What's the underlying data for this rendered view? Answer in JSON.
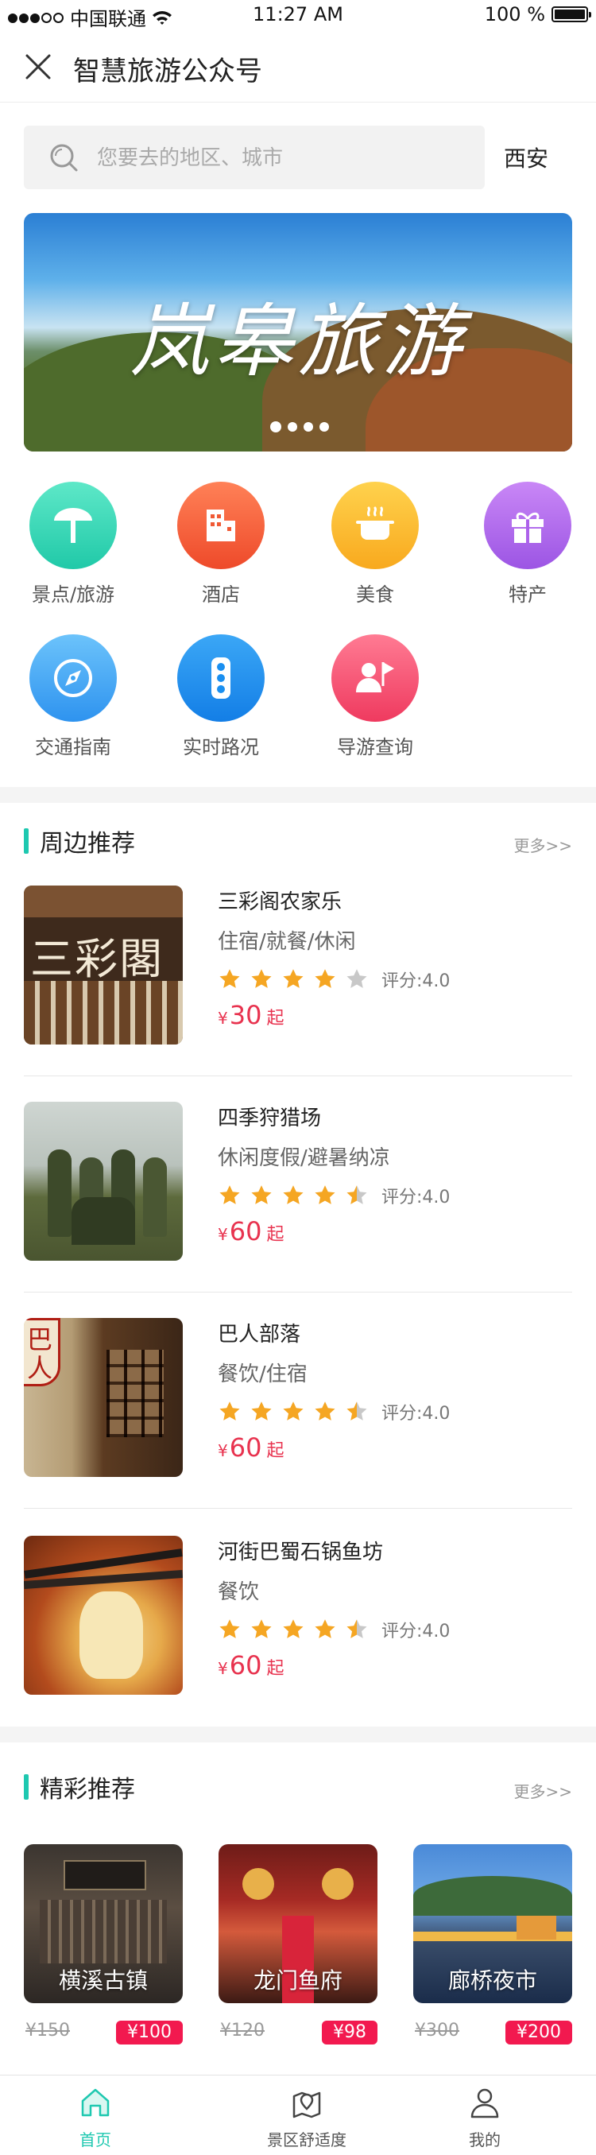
{
  "status_bar": {
    "carrier": "中国联通",
    "time": "11:27 AM",
    "battery": "100 %"
  },
  "header": {
    "title": "智慧旅游公众号"
  },
  "search": {
    "placeholder": "您要去的地区、城市",
    "city": "西安"
  },
  "banner": {
    "caption": "岚皋旅游",
    "slide_count": 4,
    "active_slide": 1
  },
  "categories": [
    {
      "label": "景点/旅游",
      "icon": "palm-tree-icon",
      "color": "#2fd6b3"
    },
    {
      "label": "酒店",
      "icon": "hotel-building-icon",
      "color": "#f5603a"
    },
    {
      "label": "美食",
      "icon": "cooking-pot-icon",
      "color": "#fbb92e"
    },
    {
      "label": "特产",
      "icon": "gift-icon",
      "color": "#b166ea"
    },
    {
      "label": "交通指南",
      "icon": "compass-icon",
      "color": "#3ea4f4"
    },
    {
      "label": "实时路况",
      "icon": "traffic-light-icon",
      "color": "#1a8ff0"
    },
    {
      "label": "导游查询",
      "icon": "guide-person-flag-icon",
      "color": "#f5476a"
    }
  ],
  "nearby": {
    "title": "周边推荐",
    "more": "更多>>",
    "items": [
      {
        "name": "三彩阁农家乐",
        "tags": "住宿/就餐/休闲",
        "rating": 4.0,
        "score_text": "评分:4.0",
        "currency": "¥",
        "price": "30",
        "suffix": "起"
      },
      {
        "name": "四季狩猎场",
        "tags": "休闲度假/避暑纳凉",
        "rating": 4.5,
        "score_text": "评分:4.0",
        "currency": "¥",
        "price": "60",
        "suffix": "起"
      },
      {
        "name": "巴人部落",
        "tags": "餐饮/住宿",
        "rating": 4.5,
        "score_text": "评分:4.0",
        "currency": "¥",
        "price": "60",
        "suffix": "起"
      },
      {
        "name": "河街巴蜀石锅鱼坊",
        "tags": "餐饮",
        "rating": 4.5,
        "score_text": "评分:4.0",
        "currency": "¥",
        "price": "60",
        "suffix": "起"
      }
    ]
  },
  "featured": {
    "title": "精彩推荐",
    "more": "更多>>",
    "cards": [
      {
        "label": "横溪古镇",
        "old_price": "¥150",
        "new_price": "¥100"
      },
      {
        "label": "龙门鱼府",
        "old_price": "¥120",
        "new_price": "¥98"
      },
      {
        "label": "廊桥夜市",
        "old_price": "¥300",
        "new_price": "¥200"
      }
    ]
  },
  "tabbar": {
    "tabs": [
      {
        "label": "首页",
        "icon": "home-icon",
        "active": true
      },
      {
        "label": "景区舒适度",
        "icon": "map-pin-icon",
        "active": false
      },
      {
        "label": "我的",
        "icon": "user-icon",
        "active": false
      }
    ]
  },
  "colors": {
    "accent": "#1ec8b0",
    "price": "#e8334f",
    "badge": "#f2194f",
    "star": "#f5a623",
    "star_empty": "#c8c8c8"
  }
}
